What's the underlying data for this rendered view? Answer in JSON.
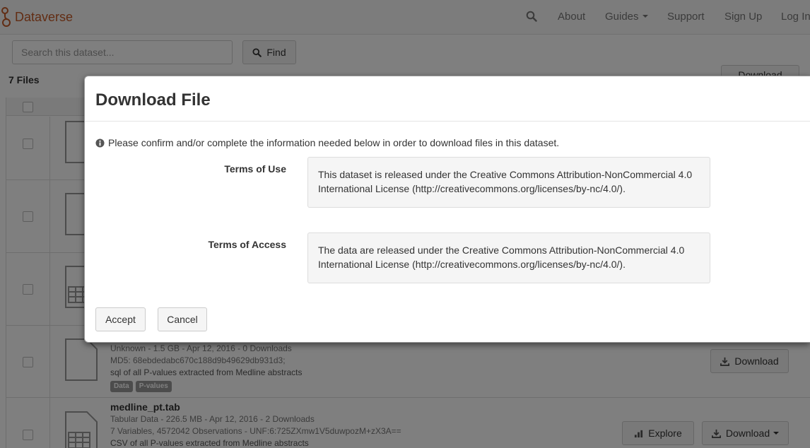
{
  "navbar": {
    "brand": "Dataverse",
    "brand_color": "#c55b28",
    "search_icon": "search-icon",
    "items": [
      {
        "label": "About"
      },
      {
        "label": "Guides",
        "dropdown": true
      },
      {
        "label": "Support"
      },
      {
        "label": "Sign Up"
      },
      {
        "label": "Log In"
      }
    ]
  },
  "search": {
    "placeholder": "Search this dataset...",
    "find_label": "Find"
  },
  "files": {
    "count_label": "7 Files",
    "download_label": "Download",
    "rows": [
      {
        "meta": "Unknown - 1.5 GB - Apr 12, 2016 - 0 Downloads",
        "md5": "MD5: 68ebdedabc670c188d9b49629db931d3;",
        "description": "sql of all P-values extracted from Medline abstracts",
        "tags": [
          "Data",
          "P-values"
        ],
        "download_label": "Download"
      },
      {
        "name": "medline_pt.tab",
        "meta": "Tabular Data - 226.5 MB - Apr 12, 2016 - 2 Downloads",
        "unf": "7 Variables, 4572042 Observations - UNF:6:725ZXmw1V5duwpozM+zX3A==",
        "description": "CSV of all P-values extracted from Medline abstracts",
        "explore_label": "Explore",
        "download_label": "Download"
      }
    ]
  },
  "modal": {
    "title": "Download File",
    "info": "Please confirm and/or complete the information needed below in order to download files in this dataset.",
    "terms_of_use_label": "Terms of Use",
    "terms_of_use": "This dataset is released under the Creative Commons Attribution-NonCommercial 4.0 International License (http://creativecommons.org/licenses/by-nc/4.0/).",
    "terms_of_access_label": "Terms of Access",
    "terms_of_access": "The data are released under the Creative Commons Attribution-NonCommercial 4.0 International License (http://creativecommons.org/licenses/by-nc/4.0/).",
    "accept_label": "Accept",
    "cancel_label": "Cancel"
  }
}
